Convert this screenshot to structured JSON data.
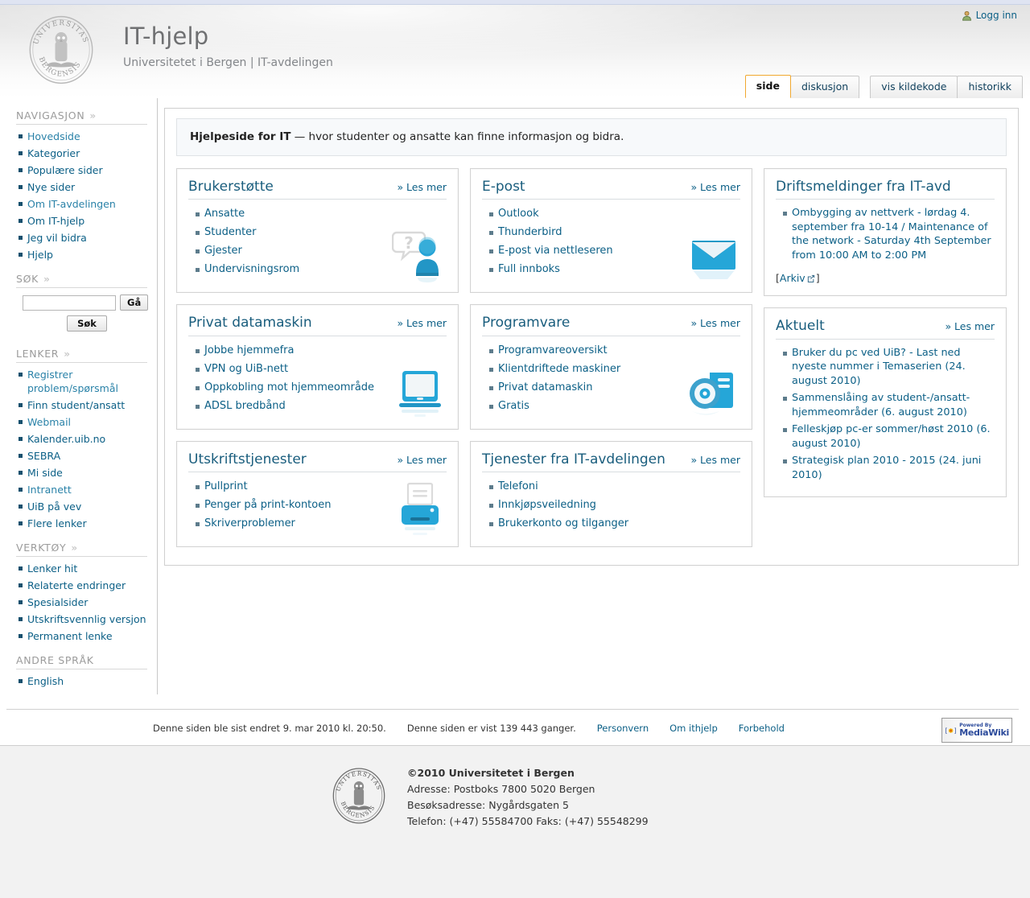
{
  "header": {
    "title": "IT-hjelp",
    "subtitle": "Universitetet i Bergen | IT-avdelingen",
    "login_label": "Logg inn",
    "login_icon": "user-icon",
    "seal_text_top": "UNIVERSITAS",
    "seal_text_bottom": "BERGENSIS"
  },
  "tabs": {
    "content_tabs": [
      {
        "label": "side",
        "active": true
      },
      {
        "label": "diskusjon",
        "active": false
      }
    ],
    "action_tabs": [
      {
        "label": "vis kildekode",
        "active": false
      },
      {
        "label": "historikk",
        "active": false
      }
    ]
  },
  "sidebar": {
    "navigation": {
      "heading": "NAVIGASJON",
      "items": [
        "Hovedside",
        "Kategorier",
        "Populære sider",
        "Nye sider",
        "Om IT-avdelingen",
        "Om IT-hjelp",
        "Jeg vil bidra",
        "Hjelp"
      ]
    },
    "search": {
      "heading": "SØK",
      "value": "",
      "placeholder": "",
      "go_label": "Gå",
      "search_label": "Søk"
    },
    "links": {
      "heading": "LENKER",
      "items": [
        "Registrer problem/spørsmål",
        "Finn student/ansatt",
        "Webmail",
        "Kalender.uib.no",
        "SEBRA",
        "Mi side",
        "Intranett",
        "UiB på vev",
        "Flere lenker"
      ]
    },
    "tools": {
      "heading": "VERKTØY",
      "items": [
        "Lenker hit",
        "Relaterte endringer",
        "Spesialsider",
        "Utskriftsvennlig versjon",
        "Permanent lenke"
      ]
    },
    "languages": {
      "heading": "ANDRE SPRÅK",
      "items": [
        "English"
      ]
    }
  },
  "main": {
    "intro_bold": "Hjelpeside for IT",
    "intro_rest": " — hvor studenter og ansatte kan finne informasjon og bidra.",
    "les_mer": "» Les mer",
    "cards": [
      {
        "title": "Brukerstøtte",
        "icon": "support-person-question-icon",
        "items": [
          "Ansatte",
          "Studenter",
          "Gjester",
          "Undervisningsrom"
        ]
      },
      {
        "title": "E-post",
        "icon": "envelope-icon",
        "items": [
          "Outlook",
          "Thunderbird",
          "E-post via nettleseren",
          "Full innboks"
        ]
      },
      {
        "title": "Privat datamaskin",
        "icon": "laptop-icon",
        "items": [
          "Jobbe hjemmefra",
          "VPN og UiB-nett",
          "Oppkobling mot hjemmeområde",
          "ADSL bredbånd"
        ]
      },
      {
        "title": "Programvare",
        "icon": "software-disc-icon",
        "items": [
          "Programvareoversikt",
          "Klientdriftede maskiner",
          "Privat datamaskin",
          "Gratis"
        ]
      },
      {
        "title": "Utskriftstjenester",
        "icon": "printer-icon",
        "items": [
          "Pullprint",
          "Penger på print-kontoen",
          "Skriverproblemer"
        ]
      },
      {
        "title": "Tjenester fra IT-avdelingen",
        "icon": "none",
        "items": [
          "Telefoni",
          "Innkjøpsveiledning",
          "Brukerkonto og tilganger"
        ]
      }
    ],
    "driftsmeldinger": {
      "title": "Driftsmeldinger fra IT-avd",
      "items": [
        "Ombygging av nettverk - lørdag 4. september fra 10-14 / Maintenance of the network - Saturday 4th September from 10:00 AM to 2:00 PM"
      ],
      "archive_open": "[",
      "archive_label": "Arkiv",
      "archive_icon": "external-link-icon",
      "archive_close": "]"
    },
    "aktuelt": {
      "title": "Aktuelt",
      "les_mer": "» Les mer",
      "items": [
        "Bruker du pc ved UiB? - Last ned nyeste nummer i Temaserien (24. august 2010)",
        "Sammenslåing av student-/ansatt-hjemmeområder (6. august 2010)",
        "Felleskjøp pc-er sommer/høst 2010 (6. august 2010)",
        "Strategisk plan 2010 - 2015 (24. juni 2010)"
      ]
    }
  },
  "footer": {
    "last_modified": "Denne siden ble sist endret 9. mar 2010 kl. 20:50.",
    "views": "Denne siden er vist 139 443 ganger.",
    "links": [
      "Personvern",
      "Om ithjelp",
      "Forbehold"
    ],
    "badge_line1": "Powered By",
    "badge_line2": "MediaWiki"
  },
  "bottom": {
    "copyright": "©2010 Universitetet i Bergen",
    "address": "Adresse: Postboks 7800 5020 Bergen",
    "visit": "Besøksadresse: Nygårdsgaten 5",
    "phone": "Telefon: (+47) 55584700 Faks: (+47) 55548299"
  },
  "colors": {
    "link": "#0b5f86",
    "heading": "#195d7d",
    "accent_tab": "#f0a830",
    "icon_blue": "#189dd0"
  }
}
